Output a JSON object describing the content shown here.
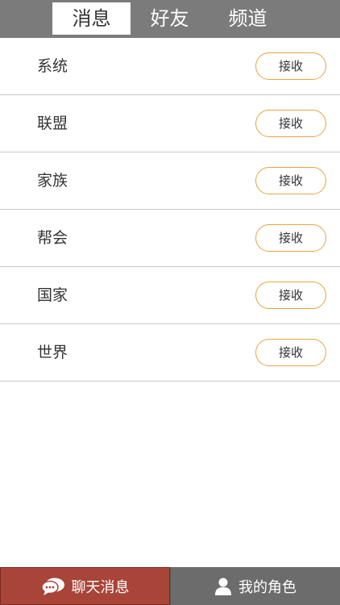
{
  "header": {
    "tabs": [
      {
        "label": "消息",
        "active": true
      },
      {
        "label": "好友",
        "active": false
      },
      {
        "label": "频道",
        "active": false
      }
    ]
  },
  "channels": [
    {
      "label": "系统",
      "button": "接收"
    },
    {
      "label": "联盟",
      "button": "接收"
    },
    {
      "label": "家族",
      "button": "接收"
    },
    {
      "label": "帮会",
      "button": "接收"
    },
    {
      "label": "国家",
      "button": "接收"
    },
    {
      "label": "世界",
      "button": "接收"
    }
  ],
  "bottom_nav": {
    "chat": {
      "label": "聊天消息",
      "icon": "chat-bubble-icon"
    },
    "role": {
      "label": "我的角色",
      "icon": "user-icon"
    }
  },
  "colors": {
    "topbar": "#7b7b7b",
    "accent_border": "#e8a33d",
    "chat_button": "#a84538",
    "role_button": "#6c6c6c"
  }
}
